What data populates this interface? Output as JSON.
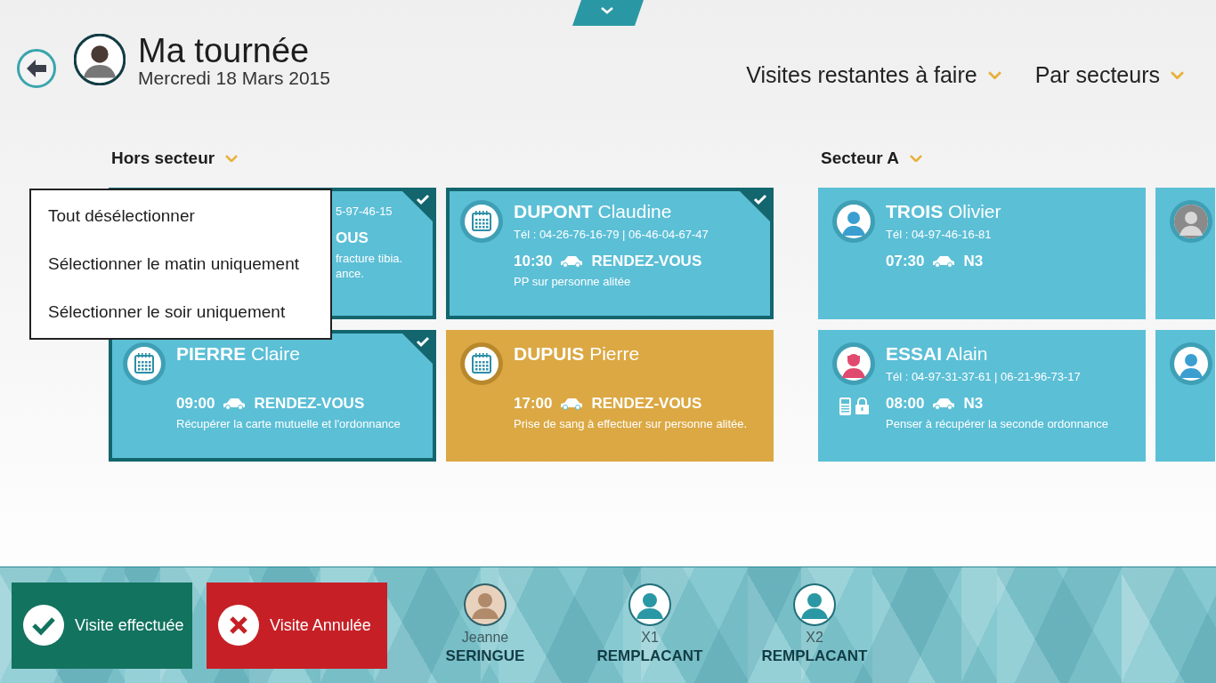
{
  "header": {
    "title": "**Ma** tournée",
    "date": "Mercredi 18 Mars 2015",
    "filters": [
      {
        "label": "Visites restantes à faire"
      },
      {
        "label": "Par secteurs"
      }
    ]
  },
  "sections": [
    {
      "title": "Hors secteur",
      "cards": [
        {
          "kind": "partial",
          "selected": true,
          "color": "#5bbfd6",
          "phone": "5-97-46-15",
          "type": "OUS",
          "note_lines": [
            "fracture tibia.",
            "ance."
          ]
        },
        {
          "kind": "full",
          "selected": true,
          "color": "#5bbfd6",
          "avatar": {
            "kind": "calendar"
          },
          "name": "**DUPONT** Claudine",
          "phone": "Tél : 04-26-76-16-79  |  06-46-04-67-47",
          "time": "10:30",
          "type": "RENDEZ-VOUS",
          "note": "PP sur personne alitée"
        },
        {
          "kind": "full",
          "selected": true,
          "color": "#5bbfd6",
          "avatar": {
            "kind": "calendar"
          },
          "name": "**PIERRE** Claire",
          "time": "09:00",
          "type": "RENDEZ-VOUS",
          "note": "Récupérer la carte mutuelle et l'ordonnance"
        },
        {
          "kind": "full",
          "selected": false,
          "color": "#dba843",
          "avatar": {
            "kind": "calendar"
          },
          "name": "**DUPUIS** Pierre",
          "time": "17:00",
          "type": "RENDEZ-VOUS",
          "note": "Prise de sang à effectuer sur personne alitée."
        }
      ]
    },
    {
      "title": "Secteur A",
      "cards": [
        {
          "kind": "full",
          "selected": false,
          "color": "#5bbfd6",
          "avatar": {
            "kind": "user"
          },
          "name": "**TROIS** Olivier",
          "phone": "Tél : 04-97-46-16-81",
          "time": "07:30",
          "type": "N3"
        },
        {
          "kind": "edge",
          "selected": false,
          "color": "#5bbfd6",
          "avatar": {
            "kind": "photo"
          }
        },
        {
          "kind": "full",
          "selected": false,
          "color": "#5bbfd6",
          "avatar": {
            "kind": "user-female"
          },
          "badges": [
            {
              "kind": "mobile"
            },
            {
              "kind": "lock"
            }
          ],
          "name": "**ESSAI** Alain",
          "phone": "Tél : 04-97-31-37-61  |  06-21-96-73-17",
          "time": "08:00",
          "type": "N3",
          "note": "Penser à récupérer la seconde ordonnance"
        },
        {
          "kind": "edge",
          "selected": false,
          "color": "#5bbfd6",
          "avatar": {
            "kind": "user"
          }
        }
      ]
    }
  ],
  "context_menu": {
    "items": [
      "Tout désélectionner",
      "Sélectionner le matin uniquement",
      "Sélectionner le soir uniquement"
    ]
  },
  "actions": [
    {
      "kind": "done",
      "label": "Visite effectuée"
    },
    {
      "kind": "cancel",
      "label": "Visite Annulée"
    }
  ],
  "staff": [
    {
      "avatar": {
        "kind": "photo"
      },
      "first": "Jeanne",
      "last": "SERINGUE"
    },
    {
      "avatar": {
        "kind": "nurse"
      },
      "first": "X1",
      "last": "REMPLACANT"
    },
    {
      "avatar": {
        "kind": "nurse"
      },
      "first": "X2",
      "last": "REMPLACANT"
    }
  ]
}
